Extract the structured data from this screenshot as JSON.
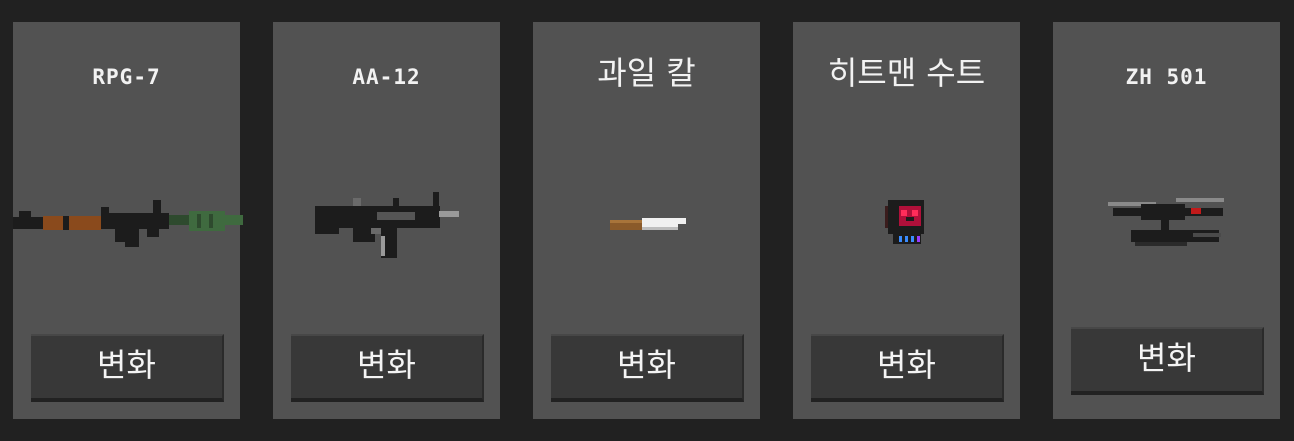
{
  "items": [
    {
      "name": "RPG-7",
      "icon": "rpg-7-rocket-launcher-icon",
      "button_label": "변화"
    },
    {
      "name": "AA-12",
      "icon": "aa-12-shotgun-icon",
      "button_label": "변화"
    },
    {
      "name": "과일 칼",
      "icon": "fruit-knife-icon",
      "button_label": "변화"
    },
    {
      "name": "히트맨 수트",
      "icon": "hitman-suit-icon",
      "button_label": "변화"
    },
    {
      "name": "ZH 501",
      "icon": "zh-501-drone-icon",
      "button_label": "변화"
    }
  ]
}
